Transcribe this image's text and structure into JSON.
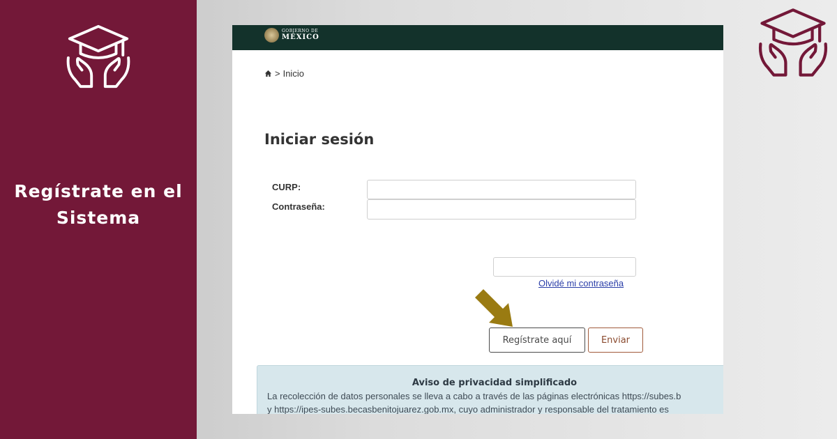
{
  "banner": {
    "title_line1": "Regístrate en el",
    "title_line2": "Sistema",
    "logo_icon": "graduation-cap-hands-icon",
    "panel_color": "#731838"
  },
  "gov_header": {
    "line1": "GOBIERNO DE",
    "line2": "MÉXICO",
    "bar_color": "#13322b"
  },
  "breadcrumb": {
    "home_icon": "home-icon",
    "separator": ">",
    "current": "Inicio"
  },
  "login": {
    "heading": "Iniciar sesión",
    "curp_label": "CURP:",
    "curp_value": "",
    "password_label": "Contraseña:",
    "password_value": "",
    "captcha_value": "",
    "forgot_link": "Olvidé mi contraseña",
    "register_button": "Regístrate aquí",
    "send_button": "Enviar"
  },
  "annotation": {
    "arrow_icon": "arrow-down-right-icon",
    "arrow_color": "#9a7b12"
  },
  "privacy_notice": {
    "title": "Aviso de privacidad simplificado",
    "line1": "La recolección de datos personales se lleva a cabo a través de las páginas electrónicas https://subes.b",
    "line2": "y https://ipes-subes.becasbenitojuarez.gob.mx, cuyo administrador y responsable del tratamiento es"
  }
}
